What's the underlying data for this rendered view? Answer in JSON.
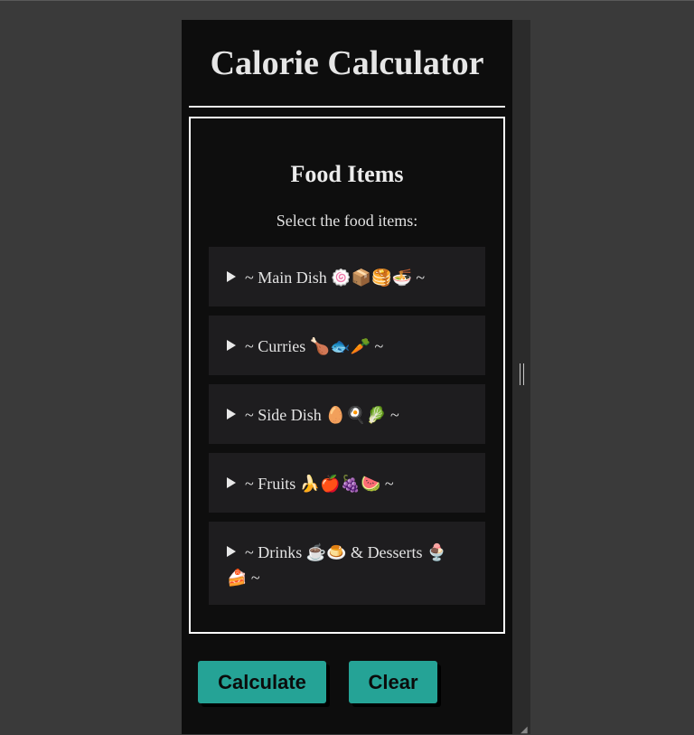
{
  "app": {
    "title": "Calorie Calculator"
  },
  "food_section": {
    "title": "Food Items",
    "subtitle": "Select the food items:",
    "categories": [
      {
        "label": "~ Main Dish 🍥📦🥞🍜 ~"
      },
      {
        "label": "~ Curries 🍗🐟🥕 ~"
      },
      {
        "label": "~ Side Dish 🥚🍳🥬 ~"
      },
      {
        "label": "~ Fruits 🍌🍎🍇🍉 ~"
      },
      {
        "label": "~ Drinks ☕🍮 & Desserts 🍨🍰 ~"
      }
    ]
  },
  "buttons": {
    "calculate": "Calculate",
    "clear": "Clear"
  },
  "colors": {
    "accent": "#25a396",
    "panel_bg": "#0d0d0d",
    "item_bg": "#1e1d1f"
  }
}
